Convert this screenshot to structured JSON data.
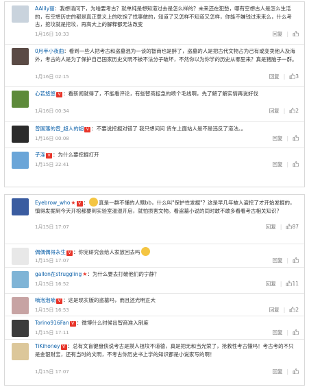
{
  "labels": {
    "reply": "回复",
    "separator": "|"
  },
  "colors": {
    "link": "#0a5fa8",
    "verified_badge": "#e8352a",
    "meta": "#999999"
  },
  "panels": [
    {
      "comments": [
        {
          "user": "AAlily丽",
          "badge": "",
          "star": false,
          "sep": "：",
          "text": "我想请问下，为啥要考古？就单纯是想知道过去是怎么样的？未来还在犯愁，哪有空想古人是怎么生活的，有空想历史的都是真正意义上的吃饱了找事做的，知道了又怎样不知道又怎样，你能不嫌钱过来来么，什么考古，挖坟就是挖坟，再高大上的解释都无法改变",
          "time": "1月16日 10:33",
          "likes": "",
          "avatar_color": "#c9d3dd"
        },
        {
          "user": "0月半小夜曲",
          "badge": "",
          "star": false,
          "sep": "：",
          "text": "看到一些人把考古和盗墓混为一谈的智商也是醉了，盗墓的人是把古代文物占为己有或变卖他人及海外，考古的人是为了保护自己国家历史文明不被不法分子破坏，不然你以为你学的历史从哪里来？真是猪脑子一群。",
          "time": "1月16日 02:15",
          "likes": "3",
          "avatar_color": "#5a4a45"
        },
        {
          "user": "心若悠悠",
          "badge": "V",
          "star": false,
          "sep": "：",
          "text": "看新闻就得了，不能看评论，有些智商捉急的喷个毛线啊，先了解了解实情再说好伐",
          "time": "1月16日 00:34",
          "likes": "2",
          "avatar_color": "#5d8a3a"
        },
        {
          "user": "曾国藩的曾_超人的超",
          "badge": "V",
          "star": false,
          "sep": "：",
          "text": "不要说挖掘对错了 我只想问问 货车上面站人是不是违反了道法。。",
          "time": "1月16日 00:08",
          "likes": "",
          "avatar_color": "#2b2b2b"
        },
        {
          "user": "子涤",
          "badge": "V",
          "star": false,
          "sep": "：",
          "text": "为什么要挖掘打开",
          "time": "1月15日 22:41",
          "likes": "",
          "avatar_color": "#6aa5d8"
        }
      ]
    },
    {
      "comments": [
        {
          "user": "Eyebrow_who",
          "badge": "V",
          "star": true,
          "sep": "：",
          "text": "真是一群不懂的人瞎bb，什么叫\"保护性发掘\"？这是早几年被人盗挖了才开始发掘的，慎得发掘到今天开棺都要到实验室温湿开启，就怕损害文物。看盗墓小说的同时敢不敢多看看考古相关知识？",
          "time": "1月15日 17:07",
          "likes": "87",
          "avatar_color": "#3a5ca0"
        },
        {
          "user": "偶偶偶得永生",
          "badge": "V",
          "star": false,
          "sep": "：",
          "text": "你完研究会给人家放回去吗",
          "time": "1月15日 17:07",
          "likes": "",
          "avatar_color": "#e8e8e8"
        },
        {
          "user": "gallon在struggling",
          "badge": "",
          "star": true,
          "sep": "：",
          "text": "为什么要去打破他们的宁静？",
          "time": "1月15日 16:52",
          "likes": "11",
          "avatar_color": "#7fb4d6"
        },
        {
          "user": "喃泡泡喃",
          "badge": "V",
          "star": false,
          "sep": "：",
          "text": "这是现实版的盗墓吗，而且还光明正大",
          "time": "1月15日 16:53",
          "likes": "2",
          "avatar_color": "#c7a3a3"
        },
        {
          "user": "Torino916Fan",
          "badge": "V",
          "star": false,
          "sep": "：",
          "text": "微博什么时候出智商准入制度",
          "time": "1月15日 17:11",
          "likes": "",
          "avatar_color": "#3c3c3c"
        },
        {
          "user": "TiKihoney",
          "badge": "V",
          "star": false,
          "sep": "：",
          "text": "总有文盲键盘侠说考古是摸人祖坟不道德，真是把无和当光荣了，抢救性考古懂吗！考古考的不只是金银财宝，还有当时的文明，不考古你历史书上学的知识都是小说家写的啊！",
          "time": "1月15日 17:07",
          "likes": "",
          "avatar_color": "#dcc79a"
        }
      ]
    }
  ]
}
